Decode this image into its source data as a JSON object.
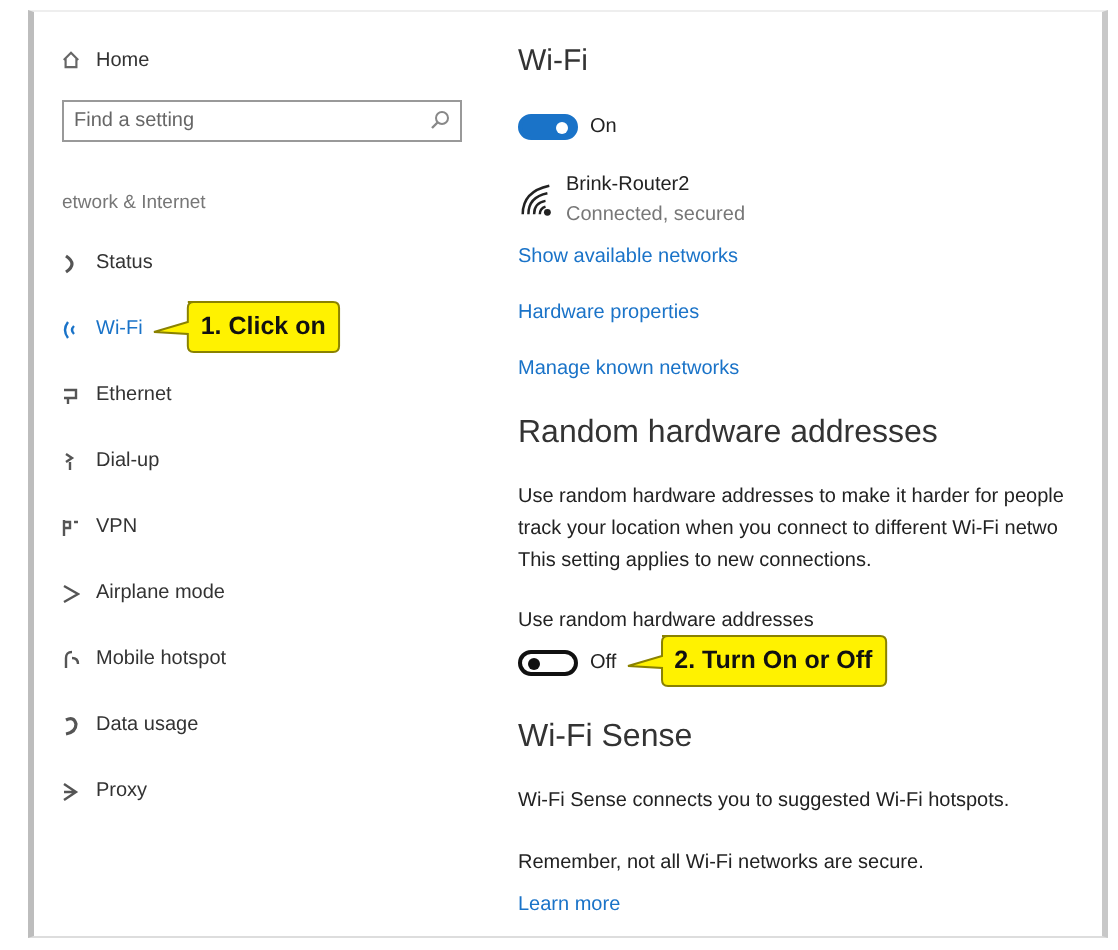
{
  "sidebar": {
    "home": "Home",
    "search": {
      "placeholder": "Find a setting"
    },
    "section": "etwork & Internet",
    "items": [
      {
        "label": "Status",
        "selected": false
      },
      {
        "label": "Wi-Fi",
        "selected": true
      },
      {
        "label": "Ethernet",
        "selected": false
      },
      {
        "label": "Dial-up",
        "selected": false
      },
      {
        "label": "VPN",
        "selected": false
      },
      {
        "label": "Airplane mode",
        "selected": false
      },
      {
        "label": "Mobile hotspot",
        "selected": false
      },
      {
        "label": "Data usage",
        "selected": false
      },
      {
        "label": "Proxy",
        "selected": false
      }
    ]
  },
  "main": {
    "title": "Wi-Fi",
    "wifi_toggle": {
      "on": true,
      "label": "On"
    },
    "network": {
      "name": "Brink-Router2",
      "status": "Connected, secured"
    },
    "links": [
      "Show available networks",
      "Hardware properties",
      "Manage known networks"
    ],
    "random_hw": {
      "heading": "Random hardware addresses",
      "description": [
        "Use random hardware addresses to make it harder for people",
        "track your location when you connect to different Wi-Fi netwo",
        "This setting applies to new connections."
      ],
      "setting_label": "Use random hardware addresses",
      "toggle": {
        "on": false,
        "label": "Off"
      }
    },
    "wifi_sense": {
      "heading": "Wi-Fi Sense",
      "paragraphs": [
        "Wi-Fi Sense connects you to suggested Wi-Fi hotspots.",
        "Remember, not all Wi-Fi networks are secure."
      ],
      "link": "Learn more"
    }
  },
  "callouts": [
    {
      "text": "1. Click on"
    },
    {
      "text": "2. Turn On or Off"
    }
  ]
}
